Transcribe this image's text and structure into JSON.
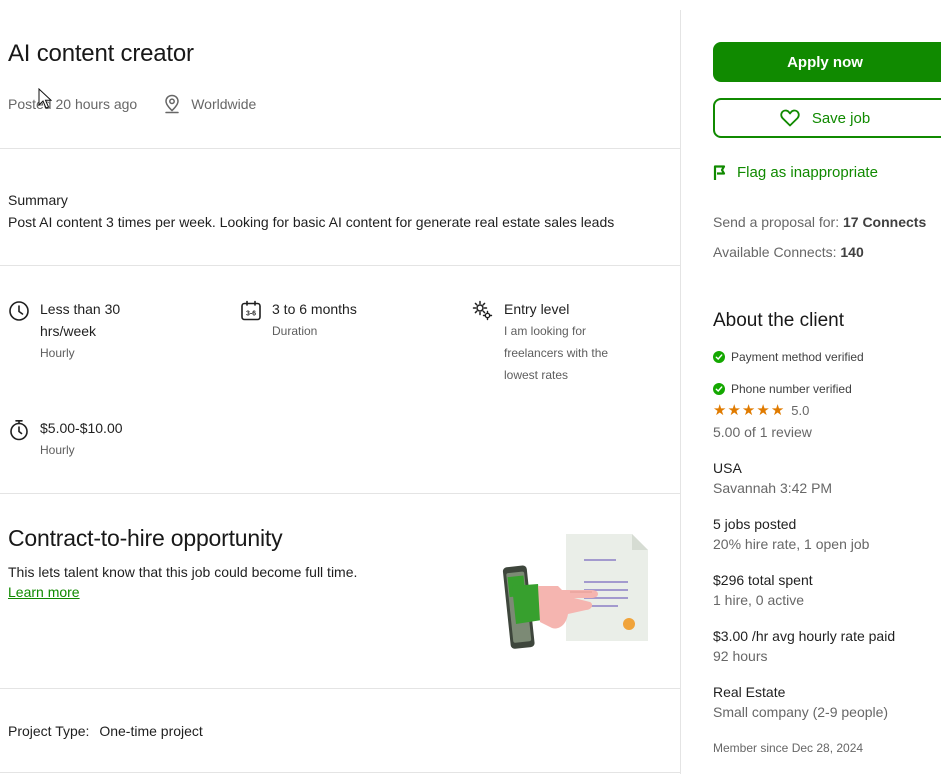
{
  "job": {
    "title": "AI content creator",
    "posted": "Posted 20 hours ago",
    "location": "Worldwide"
  },
  "summary": {
    "label": "Summary",
    "text": "Post AI content 3 times per week.  Looking for basic AI content for generate real estate sales leads"
  },
  "features": {
    "hours": {
      "title_line1": "Less than 30",
      "title_line2": "hrs/week",
      "sub": "Hourly",
      "icon": "clock-icon"
    },
    "duration": {
      "title": "3 to 6 months",
      "sub": "Duration",
      "icon": "calendar-icon",
      "badge": "3-6"
    },
    "level": {
      "title": "Entry level",
      "sub_line1": "I am looking for",
      "sub_line2": "freelancers with the",
      "sub_line3": "lowest rates",
      "icon": "gears-icon"
    },
    "rate": {
      "title": "$5.00-$10.00",
      "sub": "Hourly",
      "icon": "stopwatch-icon"
    }
  },
  "contract": {
    "title": "Contract-to-hire opportunity",
    "text": "This lets talent know that this job could become full time.",
    "link": "Learn more"
  },
  "project": {
    "label": "Project Type:",
    "value": "One-time project"
  },
  "sidebar": {
    "apply_label": "Apply now",
    "save_label": "Save job",
    "flag_label": "Flag as inappropriate",
    "proposal_label": "Send a proposal for:",
    "proposal_value": "17 Connects",
    "available_label": "Available Connects:",
    "available_value": "140"
  },
  "client": {
    "heading": "About the client",
    "payment_verified": "Payment method verified",
    "phone_verified": "Phone number verified",
    "rating": "5.0",
    "stars": 5,
    "reviews": "5.00 of 1 review",
    "country": "USA",
    "city_time": "Savannah  3:42 PM",
    "jobs_posted": "5 jobs posted",
    "hire_rate": "20% hire rate, 1 open job",
    "total_spent": "$296 total spent",
    "hires": "1 hire, 0 active",
    "avg_rate": "$3.00 /hr avg hourly rate paid",
    "hours": "92 hours",
    "industry": "Real Estate",
    "company_size": "Small company (2-9 people)",
    "member_since": "Member since Dec 28, 2024"
  },
  "colors": {
    "accent": "#108a00",
    "star": "#e07b00",
    "verified": "#14a800",
    "divider": "#e4e4e4"
  }
}
